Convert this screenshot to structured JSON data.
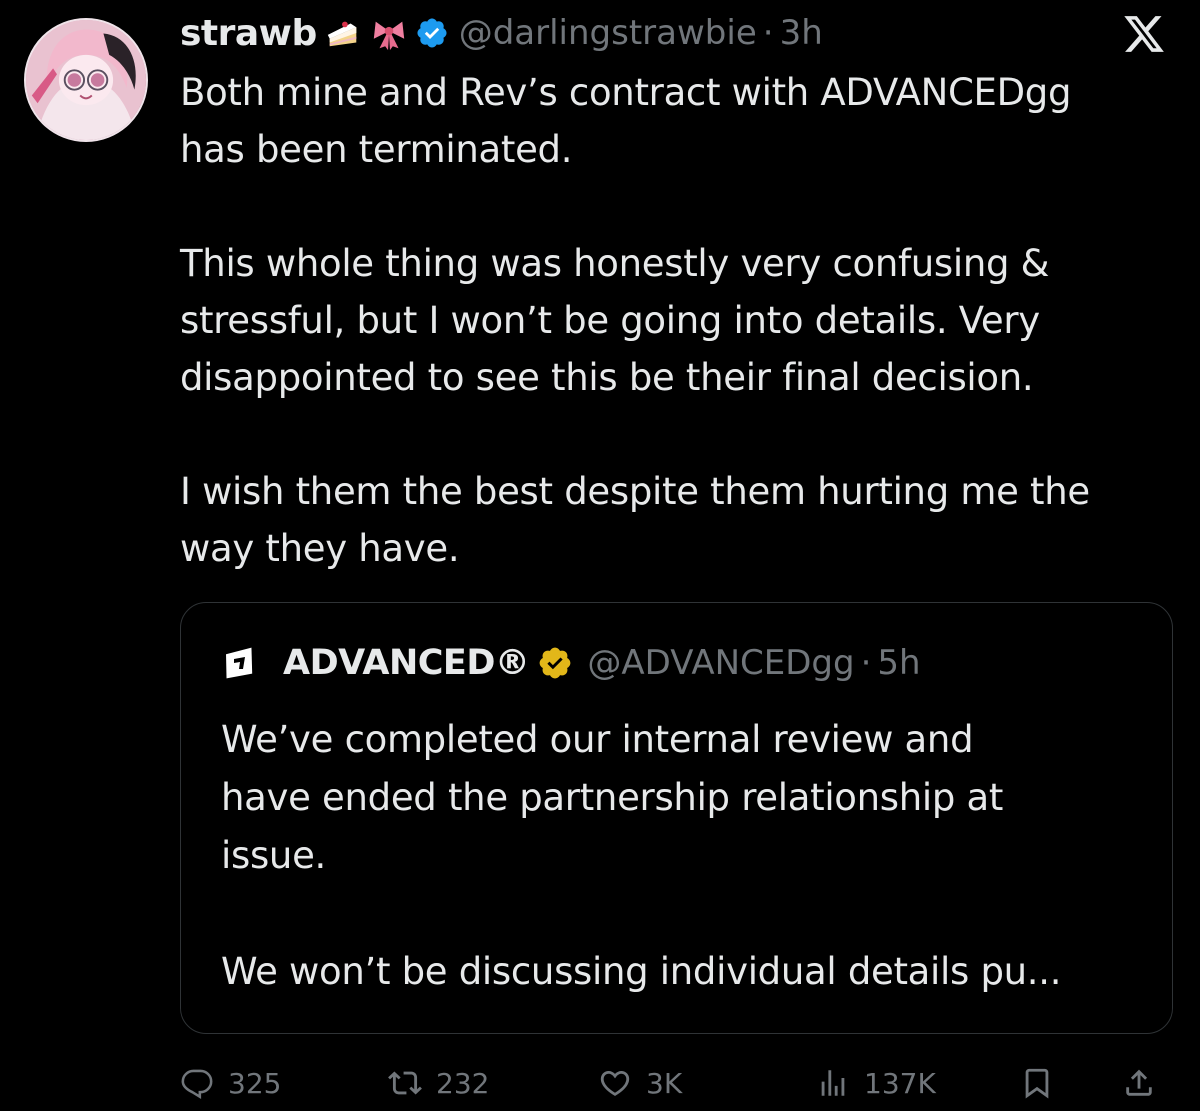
{
  "author": {
    "display_name": "strawb",
    "emojis": [
      "cake-emoji",
      "ribbon-emoji"
    ],
    "handle": "@darlingstrawbie",
    "separator": "·",
    "time": "3h",
    "verified_color": "#1d9bf0"
  },
  "tweet": {
    "text": "Both mine and Rev’s contract with ADVANCEDgg\nhas been terminated.\n\nThis whole thing was honestly very confusing &\nstressful, but I won’t be going into details. Very\ndisappointed to see this be their final decision.\n\nI wish them the best despite them hurting me the\nway they have."
  },
  "quote": {
    "display_name": "ADVANCED®",
    "handle": "@ADVANCEDgg",
    "separator": "·",
    "time": "5h",
    "verified_color": "#e2b719",
    "text": "We’ve completed our internal review and\nhave ended the partnership relationship at\nissue.\n\nWe won’t be discussing individual details pu..."
  },
  "actions": {
    "replies": "325",
    "reposts": "232",
    "likes": "3K",
    "views": "137K",
    "icons": [
      "reply-icon",
      "repost-icon",
      "like-icon",
      "views-icon",
      "bookmark-icon",
      "share-icon"
    ]
  },
  "colors": {
    "background": "#000000",
    "text": "#e7e9ea",
    "muted": "#71767b",
    "border": "#2f3336"
  }
}
